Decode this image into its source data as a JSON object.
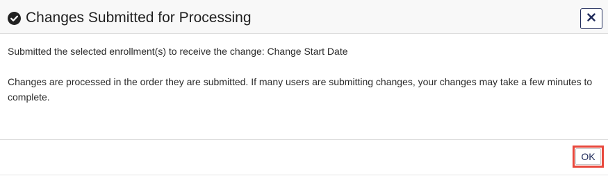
{
  "dialog": {
    "title": "Changes Submitted for Processing",
    "header_icon": "check-circle-icon",
    "close_icon": "close-icon",
    "message_line1": "Submitted the selected enrollment(s) to receive the change: Change Start Date",
    "message_line2": "Changes are processed in the order they are submitted. If many users are submitting changes, your changes may take a few minutes to complete.",
    "ok_label": "OK"
  },
  "colors": {
    "accent": "#1f2a5a",
    "highlight": "#e8473b",
    "header_bg": "#f8f8f8"
  }
}
